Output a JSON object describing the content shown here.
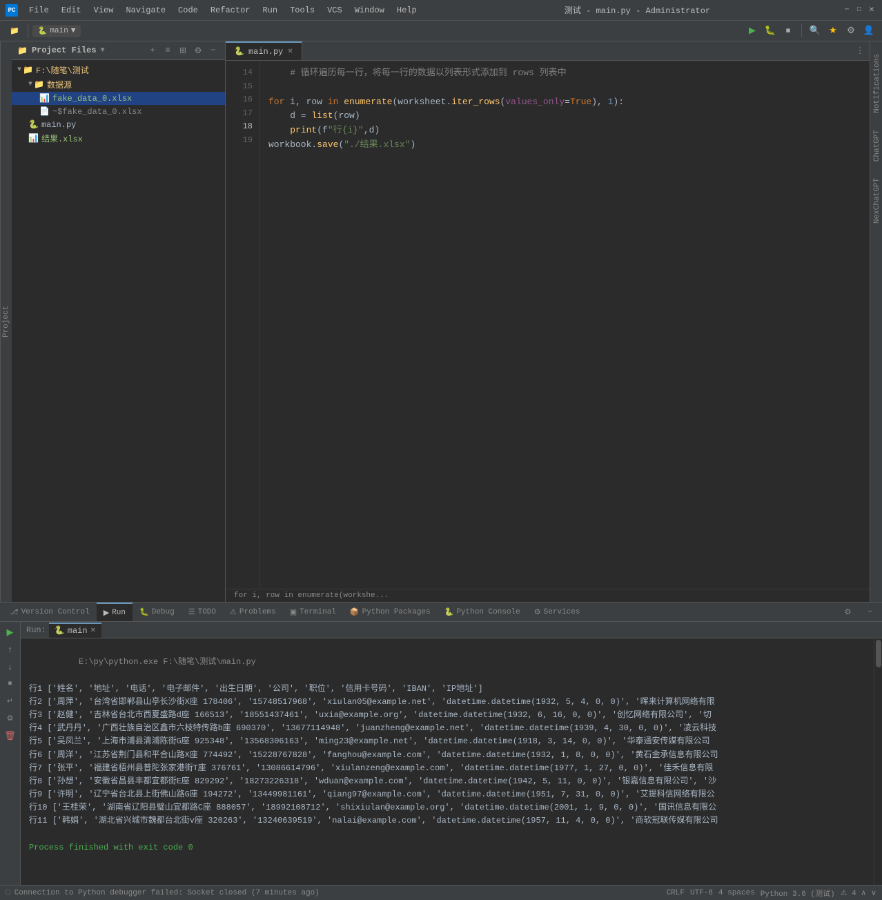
{
  "window": {
    "title": "测试 - main.py - Administrator",
    "app_icon": "PC"
  },
  "menu": {
    "items": [
      "File",
      "Edit",
      "View",
      "Navigate",
      "Code",
      "Refactor",
      "Run",
      "Tools",
      "VCS",
      "Window",
      "Help"
    ]
  },
  "toolbar": {
    "run_config": "main",
    "run_config_arrow": "▼"
  },
  "window_controls": {
    "minimize": "─",
    "maximize": "□",
    "close": "✕"
  },
  "project_panel": {
    "title": "Project Files",
    "root": "F:\\随笔\\测试",
    "items": [
      {
        "type": "folder",
        "label": "数据源",
        "indent": 2,
        "expanded": true
      },
      {
        "type": "xlsx",
        "label": "fake_data_0.xlsx",
        "indent": 3,
        "selected": true
      },
      {
        "type": "tilde",
        "label": "~$fake_data_0.xlsx",
        "indent": 3
      },
      {
        "type": "py",
        "label": "main.py",
        "indent": 2
      },
      {
        "type": "xlsx",
        "label": "结果.xlsx",
        "indent": 2
      }
    ]
  },
  "editor": {
    "tab": "main.py",
    "lines": [
      {
        "num": 14,
        "content": "    # 循环遍历每一行，将每一行的数据以列表形式添加到 rows 列表中"
      },
      {
        "num": 15,
        "content": ""
      },
      {
        "num": 16,
        "content": "for i, row in enumerate(worksheet.iter_rows(values_only=True), 1):"
      },
      {
        "num": 17,
        "content": "    d = list(row)"
      },
      {
        "num": 18,
        "content": "    print(f\"行{i}\",d)"
      },
      {
        "num": 19,
        "content": "workbook.save(\"./结果.xlsx\")"
      }
    ]
  },
  "breadcrumb": "for i, row in enumerate(workshe...",
  "run_panel": {
    "tab": "main",
    "command": "E:\\py\\python.exe F:\\随笔\\测试\\main.py",
    "output_lines": [
      "行1 ['姓名', '地址', '电话', '电子邮件', '出生日期', '公司', '职位', '信用卡号码', 'IBAN', 'IP地址']",
      "行2 ['周萍', '台湾省邯郸县山亭长沙街X座 178406', '15748517968', 'xiulan05@example.net', 'datetime.datetime(1932, 5, 4, 0, 0)', '晖来计算机网络有限",
      "行3 ['赵健', '吉林省台北市西夏盛路d座 166513', '18551437461', 'uxia@example.org', 'datetime.datetime(1932, 6, 16, 0, 0)', '创忆网络有限公司', '切",
      "行4 ['武丹丹', '广西壮族自治区鑫市六枝特传路b座 690370', '13677114948', 'juanzheng@example.net', 'datetime.datetime(1939, 4, 30, 0, 0)', '凌云科技",
      "行5 ['吴凤兰', '上海市浦县清浦陈街G座 925348', '13568306163', 'ming23@example.net', 'datetime.datetime(1918, 3, 14, 0, 0)', '华泰通安传媒有限公司",
      "行6 ['周洋', '江苏省荆门县和平合山路X座 774492', '15228767828', 'fanghou@example.com', 'datetime.datetime(1932, 1, 8, 0, 0)', '黄石金承信息有限公司",
      "行7 ['张平', '福建省梧州县普陀张家港街T座 376761', '13086614796', 'xiulanzeng@example.com', 'datetime.datetime(1977, 1, 27, 0, 0)', '佳禾信息有限",
      "行8 ['孙想', '安徽省昌县丰都宜都街E座 829292', '18273226318', 'wduan@example.com', 'datetime.datetime(1942, 5, 11, 0, 0)', '银嘉信息有限公司', '沙",
      "行9 ['许明', '辽宁省台北县上街佛山路G座 194272', '13449981161', 'qiang97@example.com', 'datetime.datetime(1951, 7, 31, 0, 0)', '艾提科信网络有限公",
      "行10 ['王桂荣', '湖南省辽阳县璧山宜都路C座 888057', '18992108712', 'shixiulan@example.org', 'datetime.datetime(2001, 1, 9, 0, 0)', '国讯信息有限公",
      "行11 ['韩娟', '湖北省兴城市魏都台北街v座 320263', '13240639519', 'nalai@example.com', 'datetime.datetime(1957, 11, 4, 0, 0)', '商软冠联传媒有限公司"
    ],
    "finish": "Process finished with exit code 0"
  },
  "bottom_tabs": [
    {
      "label": "Version Control",
      "icon": "branch",
      "active": false
    },
    {
      "label": "Run",
      "icon": "play",
      "active": true
    },
    {
      "label": "Debug",
      "icon": "bug",
      "active": false
    },
    {
      "label": "TODO",
      "icon": "list",
      "active": false
    },
    {
      "label": "Problems",
      "icon": "warning",
      "active": false
    },
    {
      "label": "Terminal",
      "icon": "terminal",
      "active": false
    },
    {
      "label": "Python Packages",
      "icon": "package",
      "active": false
    },
    {
      "label": "Python Console",
      "icon": "python",
      "active": false
    },
    {
      "label": "Services",
      "icon": "service",
      "active": false
    }
  ],
  "status_bar": {
    "connection": "Connection to Python debugger failed: Socket closed (7 minutes ago)",
    "line_ending": "CRLF",
    "encoding": "UTF-8",
    "indent": "4 spaces",
    "python": "Python 3.6 (测试)"
  },
  "right_panels": {
    "notifications": "Notifications",
    "chatgpt": "ChatGPT",
    "nexchatgpt": "NexChatGPT"
  }
}
